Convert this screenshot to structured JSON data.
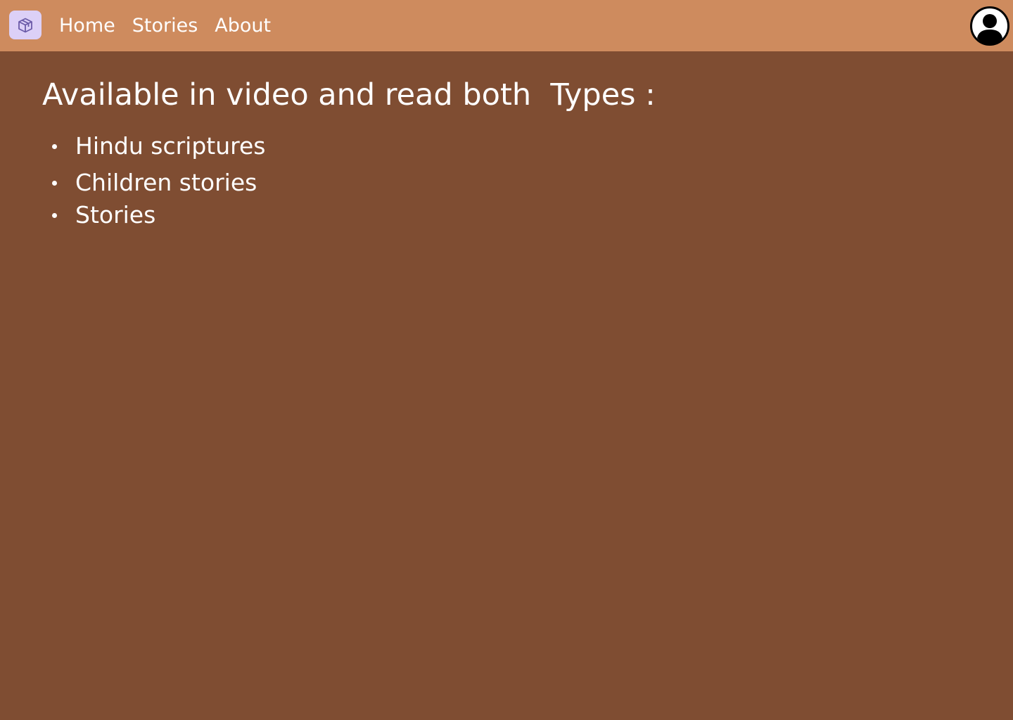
{
  "nav": {
    "links": [
      "Home",
      "Stories",
      "About"
    ],
    "logo_icon": "cube-icon",
    "profile_icon": "user-circle-icon"
  },
  "main": {
    "heading": "Available in video and read both  Types :",
    "items": [
      "Hindu scriptures",
      "Children stories",
      "Stories"
    ]
  },
  "colors": {
    "navbar": "#ce8b5e",
    "background": "#7f4d32",
    "logo_bg": "#dcd0f7",
    "text": "#ffffff"
  }
}
